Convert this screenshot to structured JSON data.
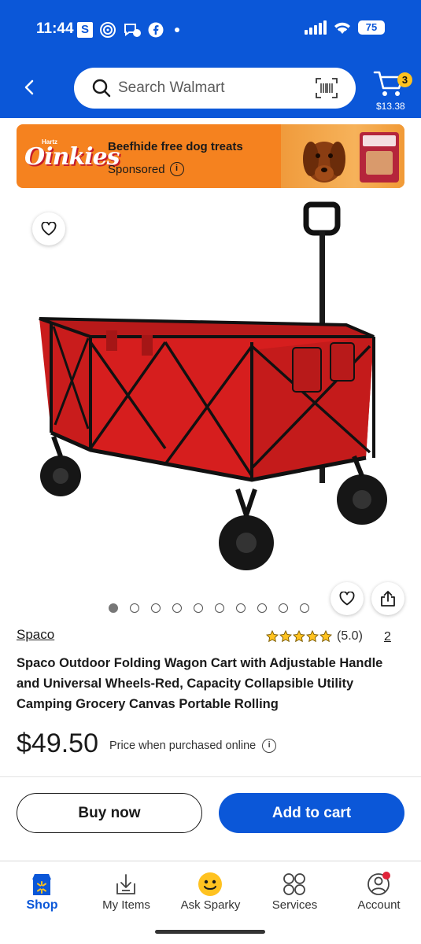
{
  "status_bar": {
    "time": "11:44",
    "battery": "75"
  },
  "header": {
    "search_placeholder": "Search Walmart",
    "cart_count": "3",
    "cart_total": "$13.38"
  },
  "sponsored_banner": {
    "brand_small": "Hartz",
    "brand": "Oinkies",
    "title": "Beefhide free dog treats",
    "sponsored_label": "Sponsored"
  },
  "product": {
    "brand": "Spaco",
    "rating_value": "(5.0)",
    "rating": 5,
    "review_count": "2",
    "title": "Spaco Outdoor Folding Wagon Cart with Adjustable Handle and Universal Wheels-Red, Capacity Collapsible Utility Camping Grocery Canvas Portable Rolling",
    "price": "$49.50",
    "price_note": "Price when purchased online",
    "image_count": 10,
    "active_image": 0
  },
  "actions": {
    "buy_now": "Buy now",
    "add_to_cart": "Add to cart"
  },
  "bottom_nav": {
    "items": [
      {
        "label": "Shop",
        "icon": "shop-icon",
        "active": true
      },
      {
        "label": "My Items",
        "icon": "my-items-icon",
        "active": false
      },
      {
        "label": "Ask Sparky",
        "icon": "sparky-icon",
        "active": false
      },
      {
        "label": "Services",
        "icon": "services-icon",
        "active": false
      },
      {
        "label": "Account",
        "icon": "account-icon",
        "active": false
      }
    ]
  },
  "colors": {
    "brand_blue": "#0b57d8",
    "banner_orange": "#f5821f",
    "star_yellow": "#ffc220",
    "notification_red": "#e0243a"
  }
}
